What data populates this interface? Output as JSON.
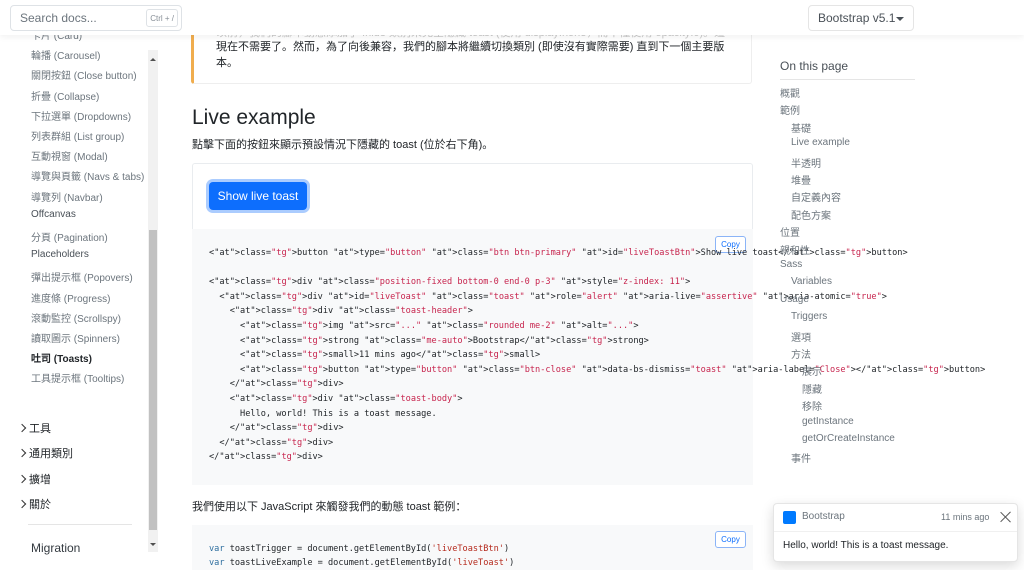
{
  "topbar": {
    "search_placeholder": "Search docs...",
    "search_shortcut": "Ctrl + /",
    "version_label": "Bootstrap v5.1"
  },
  "sidebar": {
    "items": [
      {
        "label": "卡片 (Card)",
        "state": "normal"
      },
      {
        "label": "輪播 (Carousel)",
        "state": "normal"
      },
      {
        "label": "關閉按鈕 (Close button)",
        "state": "normal"
      },
      {
        "label": "折疊 (Collapse)",
        "state": "normal"
      },
      {
        "label": "下拉選單 (Dropdowns)",
        "state": "normal"
      },
      {
        "label": "列表群組 (List group)",
        "state": "normal"
      },
      {
        "label": "互動視窗 (Modal)",
        "state": "normal"
      },
      {
        "label": "導覽與頁籤 (Navs & tabs)",
        "state": "normal"
      },
      {
        "label": "導覽列 (Navbar)",
        "state": "normal"
      },
      {
        "label": "Offcanvas",
        "state": "plain"
      },
      {
        "label": "分頁 (Pagination)",
        "state": "normal"
      },
      {
        "label": "Placeholders",
        "state": "plain"
      },
      {
        "label": "彈出提示框 (Popovers)",
        "state": "normal"
      },
      {
        "label": "進度條 (Progress)",
        "state": "normal"
      },
      {
        "label": "滾動監控 (Scrollspy)",
        "state": "normal"
      },
      {
        "label": "讀取圖示 (Spinners)",
        "state": "normal"
      },
      {
        "label": "吐司 (Toasts)",
        "state": "active"
      },
      {
        "label": "工具提示框 (Tooltips)",
        "state": "normal"
      }
    ],
    "groups": [
      "工具",
      "通用類別",
      "擴增",
      "關於"
    ],
    "migration": "Migration"
  },
  "main": {
    "callout_faded": "以前，我們的腳本動態添加了 .hide 類別來完全隱藏 toast (使用 display:none，而不僅使用 opacity:0)。這",
    "callout_text": "現在不需要了。然而，為了向後兼容，我們的腳本將繼續切換類別 (即使沒有實際需要) 直到下一個主要版本。",
    "heading": "Live example",
    "lead": "點擊下面的按鈕來顯示預設情況下隱藏的 toast (位於右下角)。",
    "live_button": "Show live toast",
    "copy_label": "Copy",
    "js_lead": "我們使用以下 JavaScript 來觸發我們的動態 toast 範例：",
    "code_html": [
      "<button type=\"button\" class=\"btn btn-primary\" id=\"liveToastBtn\">Show live toast</button>",
      "",
      "<div class=\"position-fixed bottom-0 end-0 p-3\" style=\"z-index: 11\">",
      "  <div id=\"liveToast\" class=\"toast\" role=\"alert\" aria-live=\"assertive\" aria-atomic=\"true\">",
      "    <div class=\"toast-header\">",
      "      <img src=\"...\" class=\"rounded me-2\" alt=\"...\">",
      "      <strong class=\"me-auto\">Bootstrap</strong>",
      "      <small>11 mins ago</small>",
      "      <button type=\"button\" class=\"btn-close\" data-bs-dismiss=\"toast\" aria-label=\"Close\"></button>",
      "    </div>",
      "    <div class=\"toast-body\">",
      "      Hello, world! This is a toast message.",
      "    </div>",
      "  </div>",
      "</div>"
    ],
    "code_js": [
      "var toastTrigger = document.getElementById('liveToastBtn')",
      "var toastLiveExample = document.getElementById('liveToast')"
    ]
  },
  "toc": {
    "title": "On this page",
    "items": [
      {
        "label": "概觀",
        "level": 0
      },
      {
        "label": "範例",
        "level": 0
      },
      {
        "label": "基礎",
        "level": 1
      },
      {
        "label": "Live example",
        "level": 1
      },
      {
        "label": "半透明",
        "level": 1
      },
      {
        "label": "堆疊",
        "level": 1
      },
      {
        "label": "自定義內容",
        "level": 1
      },
      {
        "label": "配色方案",
        "level": 1
      },
      {
        "label": "位置",
        "level": 0
      },
      {
        "label": "親和性",
        "level": 0
      },
      {
        "label": "Sass",
        "level": 0
      },
      {
        "label": "Variables",
        "level": 1
      },
      {
        "label": "Usage",
        "level": 0
      },
      {
        "label": "Triggers",
        "level": 1
      },
      {
        "label": "選項",
        "level": 1
      },
      {
        "label": "方法",
        "level": 1
      },
      {
        "label": "展示",
        "level": 2
      },
      {
        "label": "隱藏",
        "level": 2
      },
      {
        "label": "移除",
        "level": 2
      },
      {
        "label": "getInstance",
        "level": 2
      },
      {
        "label": "getOrCreateInstance",
        "level": 2
      },
      {
        "label": "事件",
        "level": 1
      }
    ]
  },
  "toast": {
    "title": "Bootstrap",
    "time": "11 mins ago",
    "body": "Hello, world! This is a toast message.",
    "icon_color": "#007aff"
  }
}
